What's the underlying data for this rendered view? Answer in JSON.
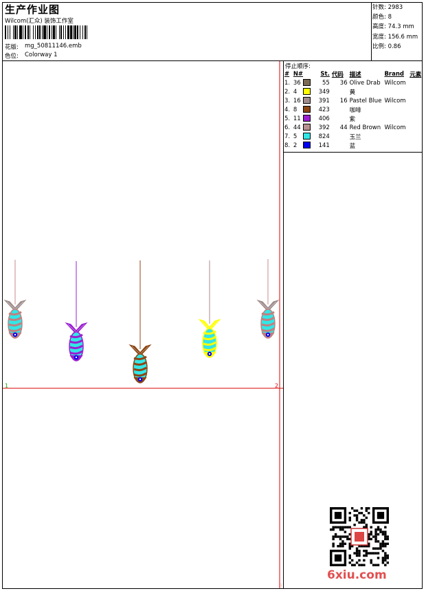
{
  "header": {
    "title": "生产作业图",
    "studio": "Wilcom(汇众) 装饰工作室",
    "design_label": "花版:",
    "design_file": "mg_50811146.emb",
    "colorway_label": "色位:",
    "colorway": "Colorway 1"
  },
  "stats": {
    "stitches": "针数: 2983",
    "colors": "颜色: 8",
    "height": "高度: 74.3 mm",
    "width": "宽度: 156.6 mm",
    "scale": "比例: 0.86"
  },
  "sequence": {
    "title": "停止顺序:",
    "columns": [
      "#",
      "N#",
      "St.",
      "代码",
      "描述",
      "Brand",
      "元素"
    ],
    "rows": [
      {
        "idx": "1.",
        "n": "36",
        "color": "#7b6a55",
        "st": "55",
        "code": "36",
        "desc": "Olive Drab",
        "brand": "Wilcom"
      },
      {
        "idx": "2.",
        "n": "4",
        "color": "#ffff00",
        "st": "349",
        "code": "",
        "desc": "黄",
        "brand": ""
      },
      {
        "idx": "3.",
        "n": "16",
        "color": "#a08c8c",
        "st": "391",
        "code": "16",
        "desc": "Pastel Blue",
        "brand": "Wilcom"
      },
      {
        "idx": "4.",
        "n": "8",
        "color": "#8b4513",
        "st": "423",
        "code": "",
        "desc": "咖啡",
        "brand": ""
      },
      {
        "idx": "5.",
        "n": "11",
        "color": "#9b1fd1",
        "st": "406",
        "code": "",
        "desc": "紫",
        "brand": ""
      },
      {
        "idx": "6.",
        "n": "44",
        "color": "#b89090",
        "st": "392",
        "code": "44",
        "desc": "Red Brown",
        "brand": "Wilcom"
      },
      {
        "idx": "7.",
        "n": "5",
        "color": "#33e6e6",
        "st": "824",
        "code": "",
        "desc": "玉兰",
        "brand": ""
      },
      {
        "idx": "8.",
        "n": "2",
        "color": "#0000ee",
        "st": "141",
        "code": "",
        "desc": "蓝",
        "brand": ""
      }
    ]
  },
  "canvas": {
    "marker_1": "1",
    "marker_2": "2",
    "fish": [
      {
        "name": "fish-1",
        "string": "#c78b8b",
        "tail": "#a08c8c",
        "band": "#c08080",
        "body": "#33e6e6"
      },
      {
        "name": "fish-2",
        "string": "#9b1fd1",
        "tail": "#9b1fd1",
        "band": "#9b1fd1",
        "body": "#33e6e6"
      },
      {
        "name": "fish-3",
        "string": "#8b4513",
        "tail": "#8b4513",
        "band": "#8b4513",
        "body": "#33e6e6"
      },
      {
        "name": "fish-4",
        "string": "#ad8b8b",
        "tail": "#ffff00",
        "band": "#ffff00",
        "body": "#33e6e6"
      },
      {
        "name": "fish-5",
        "string": "#c78b8b",
        "tail": "#a08c8c",
        "band": "#c08080",
        "body": "#33e6e6"
      }
    ]
  },
  "watermark": "6xiu.com",
  "colors": {
    "guide_red": "#dd0000",
    "marker_green": "#00aa00"
  }
}
